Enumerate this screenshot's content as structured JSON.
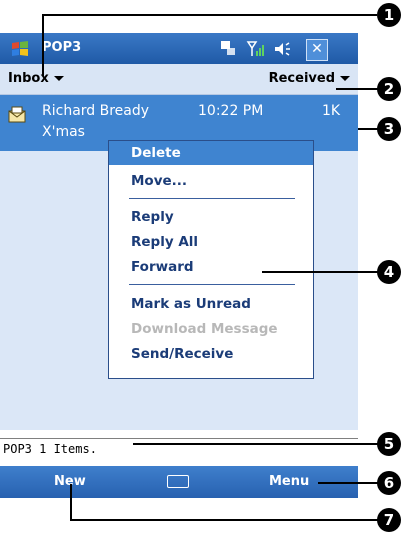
{
  "window": {
    "title": "POP3"
  },
  "header": {
    "folder": "Inbox",
    "sort": "Received"
  },
  "message": {
    "sender": "Richard Bready",
    "time": "10:22 PM",
    "size": "1K",
    "subject": "X'mas"
  },
  "context_menu": {
    "items": [
      "Delete",
      "Move...",
      "Reply",
      "Reply All",
      "Forward",
      "Mark as Unread",
      "Download Message",
      "Send/Receive"
    ],
    "selected": "Delete",
    "disabled": [
      "Download Message"
    ]
  },
  "status": {
    "text": "POP3 1 Items."
  },
  "softkeys": {
    "left": "New",
    "right": "Menu"
  },
  "callouts": [
    "1",
    "2",
    "3",
    "4",
    "5",
    "6",
    "7"
  ],
  "icons": [
    "windows-logo-icon",
    "sync-icon",
    "signal-icon",
    "volume-icon",
    "close-icon",
    "envelope-icon",
    "keyboard-icon"
  ],
  "colors": {
    "titlebar": "#2a67b5",
    "header": "#d9e5f5",
    "selection": "#3f84d0",
    "menu_text": "#1b3c78",
    "list_bg": "#dbe7f7"
  }
}
